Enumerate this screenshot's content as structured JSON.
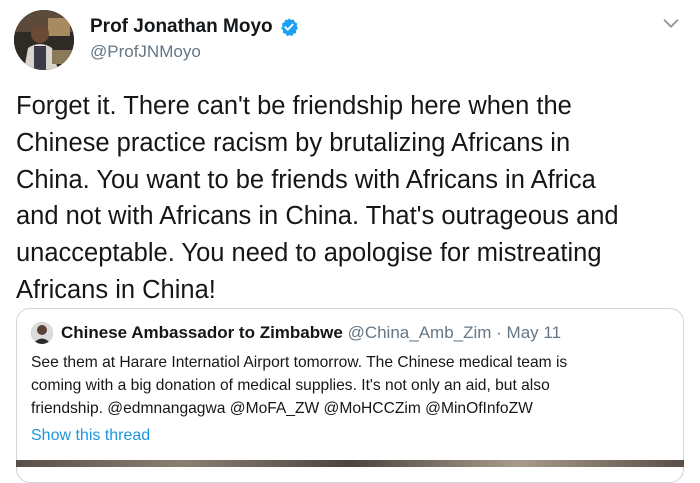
{
  "tweet": {
    "author": {
      "display_name": "Prof Jonathan Moyo",
      "handle": "@ProfJNMoyo",
      "verified": true
    },
    "text": "Forget it. There can't be friendship here when the\nChinese practice racism by brutalizing Africans in\nChina. You want to be friends with Africans in Africa\nand not with Africans in China. That's outrageous and\nunacceptable. You need to apologise for mistreating\nAfricans in China!",
    "menu_icon": "chevron-down-icon"
  },
  "quoted_tweet": {
    "author": {
      "display_name": "Chinese Ambassador to Zimbabwe",
      "handle": "@China_Amb_Zim",
      "separator": " · ",
      "date": "May 11"
    },
    "text": "See them at Harare Internatiol Airport tomorrow. The Chinese medical team is\ncoming with a big donation of medical supplies. It's not only an aid, but also\nfriendship. @edmnangagwa @MoFA_ZW @MoHCCZim @MinOfInfoZW",
    "show_thread_label": "Show this thread"
  },
  "colors": {
    "text_primary": "#14171a",
    "text_secondary": "#657786",
    "link": "#1b95e0",
    "verified_badge": "#1da1f2",
    "border": "#ccd6dd"
  }
}
